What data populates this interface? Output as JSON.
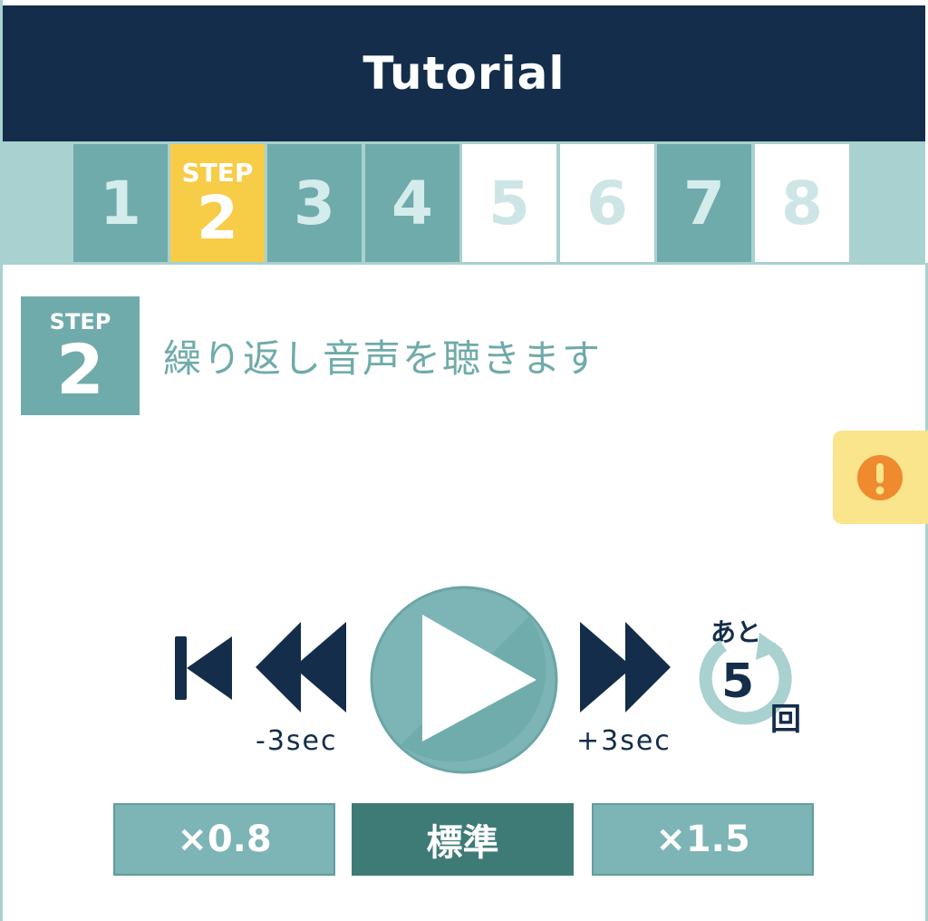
{
  "header": {
    "title": "Tutorial"
  },
  "steps": {
    "items": [
      {
        "label": "1",
        "state": "done"
      },
      {
        "label": "2",
        "state": "current",
        "prefix": "STEP"
      },
      {
        "label": "3",
        "state": "done"
      },
      {
        "label": "4",
        "state": "done"
      },
      {
        "label": "5",
        "state": "future"
      },
      {
        "label": "6",
        "state": "future"
      },
      {
        "label": "7",
        "state": "done"
      },
      {
        "label": "8",
        "state": "future"
      }
    ]
  },
  "current_step": {
    "badge_word": "STEP",
    "badge_number": "2",
    "instruction": "繰り返し音声を聴きます"
  },
  "alert": {
    "icon": "exclamation-circle-icon"
  },
  "player": {
    "rewind_label": "-3sec",
    "forward_label": "+3sec",
    "remaining_prefix": "あと",
    "remaining_count": "5",
    "remaining_unit": "回",
    "icons": {
      "skip_back": "skip-to-start-icon",
      "rewind": "rewind-icon",
      "play": "play-icon",
      "forward": "fast-forward-icon",
      "repeat": "repeat-icon"
    }
  },
  "speed": {
    "options": [
      {
        "label": "×0.8",
        "active": false
      },
      {
        "label": "標準",
        "active": true
      },
      {
        "label": "×1.5",
        "active": false
      }
    ]
  },
  "colors": {
    "navy": "#132d4a",
    "teal": "#6fabaa",
    "light_teal": "#a8d1cf",
    "yellow": "#f7cc47",
    "alert_bg": "#fae48c",
    "alert_icon": "#ef8a2e",
    "active_speed": "#3f7b76"
  }
}
